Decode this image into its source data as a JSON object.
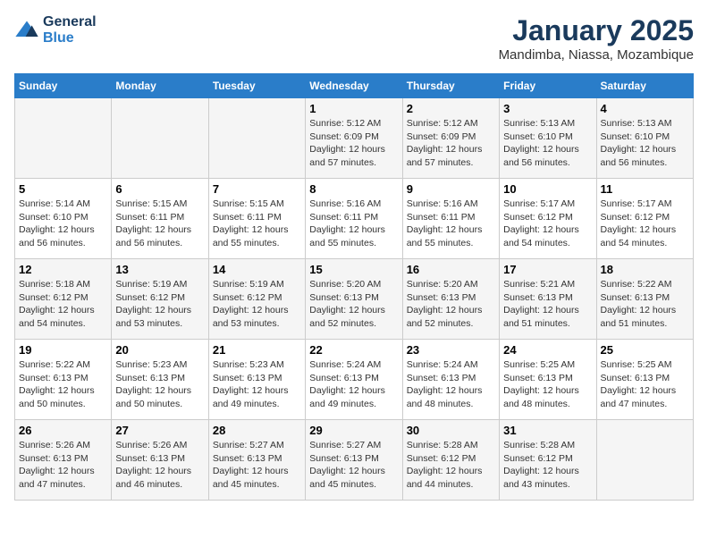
{
  "logo": {
    "line1": "General",
    "line2": "Blue"
  },
  "title": "January 2025",
  "subtitle": "Mandimba, Niassa, Mozambique",
  "weekdays": [
    "Sunday",
    "Monday",
    "Tuesday",
    "Wednesday",
    "Thursday",
    "Friday",
    "Saturday"
  ],
  "weeks": [
    [
      {
        "day": "",
        "info": ""
      },
      {
        "day": "",
        "info": ""
      },
      {
        "day": "",
        "info": ""
      },
      {
        "day": "1",
        "info": "Sunrise: 5:12 AM\nSunset: 6:09 PM\nDaylight: 12 hours\nand 57 minutes."
      },
      {
        "day": "2",
        "info": "Sunrise: 5:12 AM\nSunset: 6:09 PM\nDaylight: 12 hours\nand 57 minutes."
      },
      {
        "day": "3",
        "info": "Sunrise: 5:13 AM\nSunset: 6:10 PM\nDaylight: 12 hours\nand 56 minutes."
      },
      {
        "day": "4",
        "info": "Sunrise: 5:13 AM\nSunset: 6:10 PM\nDaylight: 12 hours\nand 56 minutes."
      }
    ],
    [
      {
        "day": "5",
        "info": "Sunrise: 5:14 AM\nSunset: 6:10 PM\nDaylight: 12 hours\nand 56 minutes."
      },
      {
        "day": "6",
        "info": "Sunrise: 5:15 AM\nSunset: 6:11 PM\nDaylight: 12 hours\nand 56 minutes."
      },
      {
        "day": "7",
        "info": "Sunrise: 5:15 AM\nSunset: 6:11 PM\nDaylight: 12 hours\nand 55 minutes."
      },
      {
        "day": "8",
        "info": "Sunrise: 5:16 AM\nSunset: 6:11 PM\nDaylight: 12 hours\nand 55 minutes."
      },
      {
        "day": "9",
        "info": "Sunrise: 5:16 AM\nSunset: 6:11 PM\nDaylight: 12 hours\nand 55 minutes."
      },
      {
        "day": "10",
        "info": "Sunrise: 5:17 AM\nSunset: 6:12 PM\nDaylight: 12 hours\nand 54 minutes."
      },
      {
        "day": "11",
        "info": "Sunrise: 5:17 AM\nSunset: 6:12 PM\nDaylight: 12 hours\nand 54 minutes."
      }
    ],
    [
      {
        "day": "12",
        "info": "Sunrise: 5:18 AM\nSunset: 6:12 PM\nDaylight: 12 hours\nand 54 minutes."
      },
      {
        "day": "13",
        "info": "Sunrise: 5:19 AM\nSunset: 6:12 PM\nDaylight: 12 hours\nand 53 minutes."
      },
      {
        "day": "14",
        "info": "Sunrise: 5:19 AM\nSunset: 6:12 PM\nDaylight: 12 hours\nand 53 minutes."
      },
      {
        "day": "15",
        "info": "Sunrise: 5:20 AM\nSunset: 6:13 PM\nDaylight: 12 hours\nand 52 minutes."
      },
      {
        "day": "16",
        "info": "Sunrise: 5:20 AM\nSunset: 6:13 PM\nDaylight: 12 hours\nand 52 minutes."
      },
      {
        "day": "17",
        "info": "Sunrise: 5:21 AM\nSunset: 6:13 PM\nDaylight: 12 hours\nand 51 minutes."
      },
      {
        "day": "18",
        "info": "Sunrise: 5:22 AM\nSunset: 6:13 PM\nDaylight: 12 hours\nand 51 minutes."
      }
    ],
    [
      {
        "day": "19",
        "info": "Sunrise: 5:22 AM\nSunset: 6:13 PM\nDaylight: 12 hours\nand 50 minutes."
      },
      {
        "day": "20",
        "info": "Sunrise: 5:23 AM\nSunset: 6:13 PM\nDaylight: 12 hours\nand 50 minutes."
      },
      {
        "day": "21",
        "info": "Sunrise: 5:23 AM\nSunset: 6:13 PM\nDaylight: 12 hours\nand 49 minutes."
      },
      {
        "day": "22",
        "info": "Sunrise: 5:24 AM\nSunset: 6:13 PM\nDaylight: 12 hours\nand 49 minutes."
      },
      {
        "day": "23",
        "info": "Sunrise: 5:24 AM\nSunset: 6:13 PM\nDaylight: 12 hours\nand 48 minutes."
      },
      {
        "day": "24",
        "info": "Sunrise: 5:25 AM\nSunset: 6:13 PM\nDaylight: 12 hours\nand 48 minutes."
      },
      {
        "day": "25",
        "info": "Sunrise: 5:25 AM\nSunset: 6:13 PM\nDaylight: 12 hours\nand 47 minutes."
      }
    ],
    [
      {
        "day": "26",
        "info": "Sunrise: 5:26 AM\nSunset: 6:13 PM\nDaylight: 12 hours\nand 47 minutes."
      },
      {
        "day": "27",
        "info": "Sunrise: 5:26 AM\nSunset: 6:13 PM\nDaylight: 12 hours\nand 46 minutes."
      },
      {
        "day": "28",
        "info": "Sunrise: 5:27 AM\nSunset: 6:13 PM\nDaylight: 12 hours\nand 45 minutes."
      },
      {
        "day": "29",
        "info": "Sunrise: 5:27 AM\nSunset: 6:13 PM\nDaylight: 12 hours\nand 45 minutes."
      },
      {
        "day": "30",
        "info": "Sunrise: 5:28 AM\nSunset: 6:12 PM\nDaylight: 12 hours\nand 44 minutes."
      },
      {
        "day": "31",
        "info": "Sunrise: 5:28 AM\nSunset: 6:12 PM\nDaylight: 12 hours\nand 43 minutes."
      },
      {
        "day": "",
        "info": ""
      }
    ]
  ]
}
